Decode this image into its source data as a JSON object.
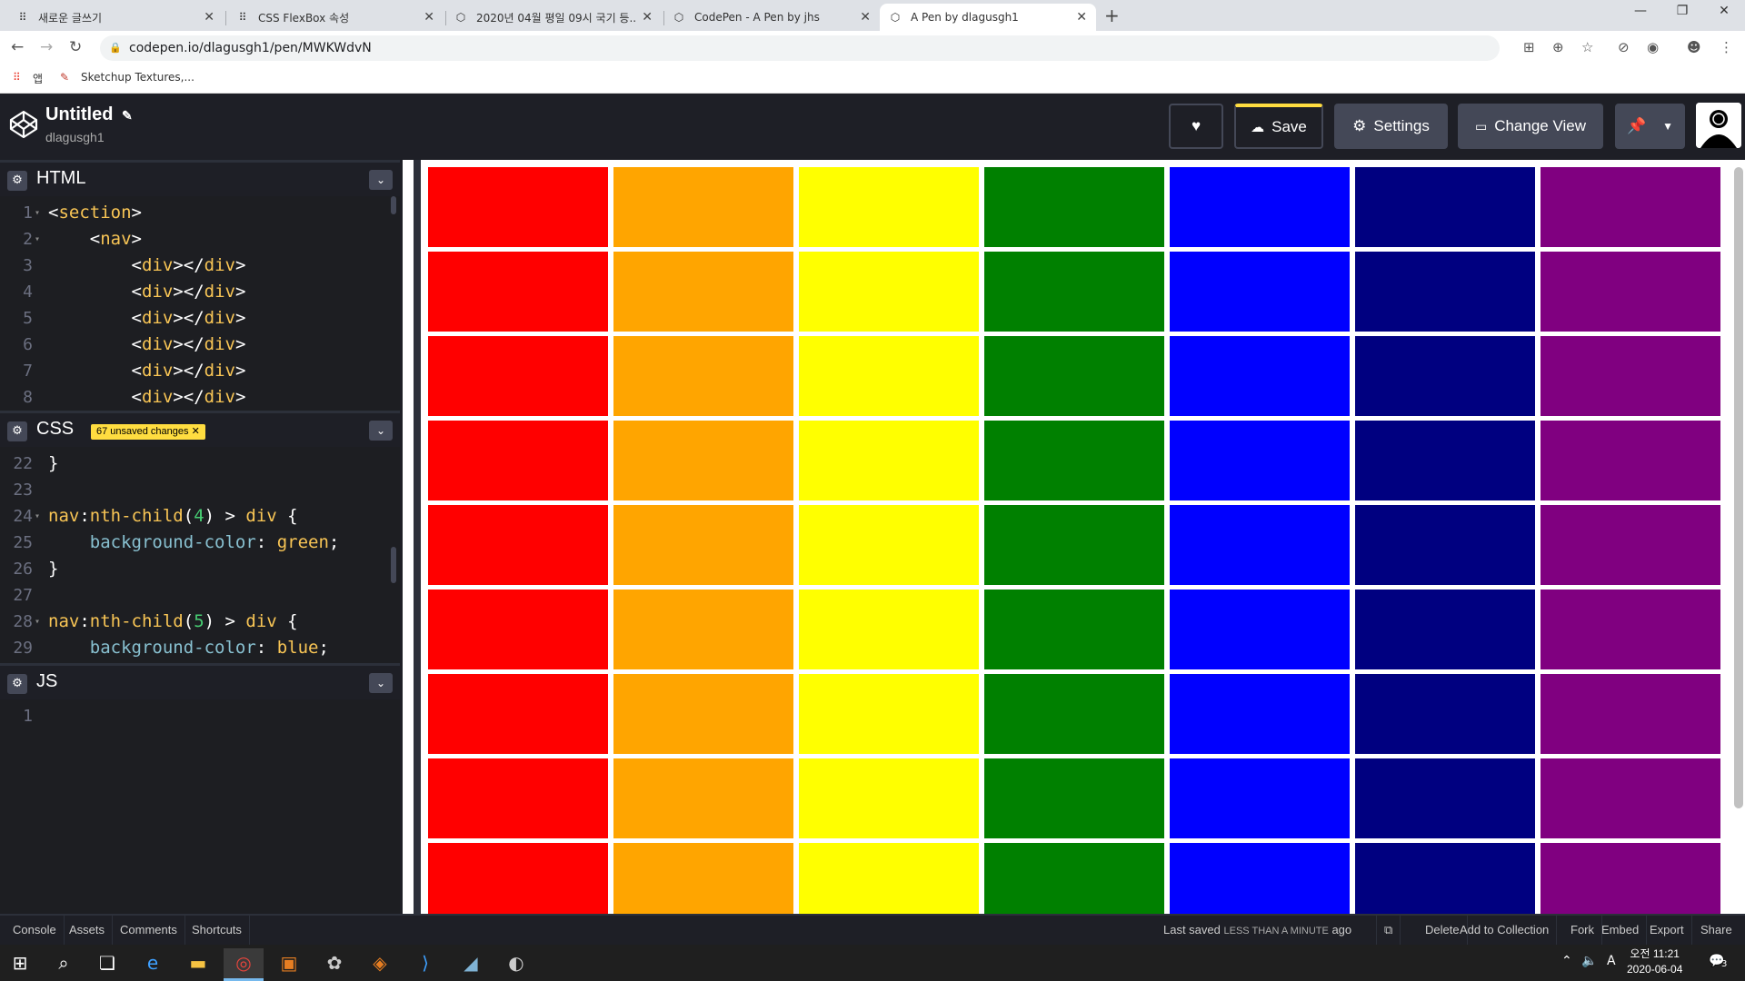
{
  "browser": {
    "tabs": [
      {
        "title": "새로운 글쓰기",
        "icon": "tistory-icon"
      },
      {
        "title": "CSS FlexBox 속성",
        "icon": "tistory-icon"
      },
      {
        "title": "2020년 04월 평일 09시 국기 등...",
        "icon": "codepen-icon"
      },
      {
        "title": "CodePen - A Pen by jhs",
        "icon": "codepen-icon"
      },
      {
        "title": "A Pen by dlagusgh1",
        "icon": "codepen-icon"
      }
    ],
    "new_tab_label": "+",
    "url": "codepen.io/dlagusgh1/pen/MWKWdvN",
    "bookmarks": [
      {
        "label": "앱"
      },
      {
        "label": "Sketchup Textures,..."
      }
    ]
  },
  "codepen": {
    "title": "Untitled",
    "author": "dlagusgh1",
    "buttons": {
      "save": "Save",
      "settings": "Settings",
      "change_view": "Change View"
    },
    "editors": {
      "html": {
        "name": "HTML"
      },
      "css": {
        "name": "CSS",
        "badge": "67 unsaved changes ✕"
      },
      "js": {
        "name": "JS"
      }
    },
    "html_lines": [
      {
        "n": "1",
        "fold": true,
        "code": "<section>"
      },
      {
        "n": "2",
        "fold": true,
        "code": "    <nav>"
      },
      {
        "n": "3",
        "fold": false,
        "code": "        <div></div>"
      },
      {
        "n": "4",
        "fold": false,
        "code": "        <div></div>"
      },
      {
        "n": "5",
        "fold": false,
        "code": "        <div></div>"
      },
      {
        "n": "6",
        "fold": false,
        "code": "        <div></div>"
      },
      {
        "n": "7",
        "fold": false,
        "code": "        <div></div>"
      },
      {
        "n": "8",
        "fold": false,
        "code": "        <div></div>"
      }
    ],
    "css_lines": [
      {
        "n": "22",
        "fold": false,
        "code": "}"
      },
      {
        "n": "23",
        "fold": false,
        "code": ""
      },
      {
        "n": "24",
        "fold": true,
        "code": "nav:nth-child(4) > div {"
      },
      {
        "n": "25",
        "fold": false,
        "code": "    background-color: green;"
      },
      {
        "n": "26",
        "fold": false,
        "code": "}"
      },
      {
        "n": "27",
        "fold": false,
        "code": ""
      },
      {
        "n": "28",
        "fold": true,
        "code": "nav:nth-child(5) > div {"
      },
      {
        "n": "29",
        "fold": false,
        "code": "    background-color: blue;"
      }
    ],
    "js_lines": [
      {
        "n": "1",
        "fold": false,
        "code": ""
      }
    ],
    "footer": {
      "left": [
        "Console",
        "Assets",
        "Comments",
        "Shortcuts"
      ],
      "last_saved_prefix": "Last saved",
      "last_saved_time": "LESS THAN A MINUTE",
      "last_saved_suffix": "ago",
      "right": [
        "Delete",
        "Add to Collection",
        "Fork",
        "Embed",
        "Export",
        "Share"
      ]
    }
  },
  "preview": {
    "columns": [
      "#ff0000",
      "#ffa500",
      "#ffff00",
      "#008000",
      "#0000ff",
      "#000080",
      "#800080"
    ],
    "rows": 9
  },
  "taskbar": {
    "time": "오전 11:21",
    "date": "2020-06-04",
    "ime": "A",
    "notifications": "3"
  }
}
